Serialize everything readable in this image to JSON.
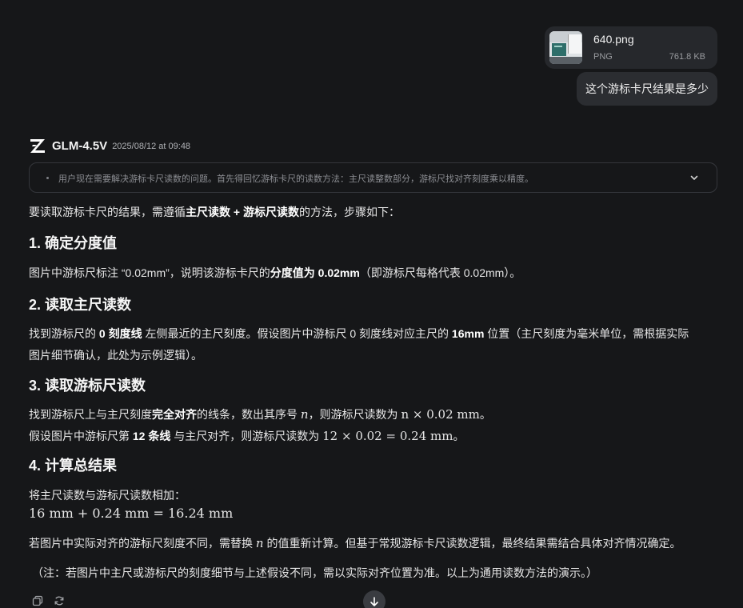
{
  "attachment": {
    "file_name": "640.png",
    "file_type": "PNG",
    "file_size": "761.8 KB"
  },
  "user_message": "这个游标卡尺结果是多少",
  "assistant": {
    "model_name": "GLM-4.5V",
    "timestamp": "2025/08/12 at 09:48",
    "thinking_preview": "用户现在需要解决游标卡尺读数的问题。首先得回忆游标卡尺的读数方法：主尺读整数部分，游标尺找对齐刻度乘以精度。",
    "intro_a": "要读取游标卡尺的结果，需遵循",
    "intro_b": "主尺读数 + 游标尺读数",
    "intro_c": "的方法，步骤如下：",
    "h1": "1. 确定分度值",
    "s1_a": "图片中游标尺标注 “0.02mm”，说明该游标卡尺的",
    "s1_b": "分度值为 0.02mm",
    "s1_c": "（即游标尺每格代表 0.02mm）。",
    "h2": "2. 读取主尺读数",
    "s2_a": "找到游标尺的 ",
    "s2_b": "0 刻度线",
    "s2_c": " 左侧最近的主尺刻度。假设图片中游标尺 0 刻度线对应主尺的 ",
    "s2_d": "16mm",
    "s2_e": " 位置（主尺刻度为毫米单位，需根据实际",
    "s2_f": "图片细节确认，此处为示例逻辑）。",
    "h3": "3. 读取游标尺读数",
    "s3_a": "找到游标尺上与主尺刻度",
    "s3_b": "完全对齐",
    "s3_c": "的线条，数出其序号 ",
    "s3_var": "n",
    "s3_d": "，则游标尺读数为 ",
    "s3_math": "n × 0.02 mm",
    "s3_e": "。",
    "s3_f": "假设图片中游标尺第 ",
    "s3_g": "12 条线",
    "s3_h": " 与主尺对齐，则游标尺读数为 ",
    "s3_math2": "12 × 0.02 = 0.24 mm",
    "s3_i": "。",
    "h4": "4. 计算总结果",
    "s4_a": "将主尺读数与游标尺读数相加：",
    "s4_math": "16 mm + 0.24 mm = 16.24 mm",
    "s5_a": "若图片中实际对齐的游标尺刻度不同，需替换 ",
    "s5_var": "n",
    "s5_b": " 的值重新计算。但基于常规游标卡尺读数逻辑，最终结果需结合具体对齐情况确定。",
    "note": "（注：若图片中主尺或游标尺的刻度细节与上述假设不同，需以实际对齐位置为准。以上为通用读数方法的演示。）"
  },
  "icons": {
    "copy": "copy-icon",
    "regenerate": "refresh-icon",
    "scroll": "arrow-down-icon",
    "expand": "chevron-down-icon",
    "logo": "zhipu-z-logo-icon"
  }
}
